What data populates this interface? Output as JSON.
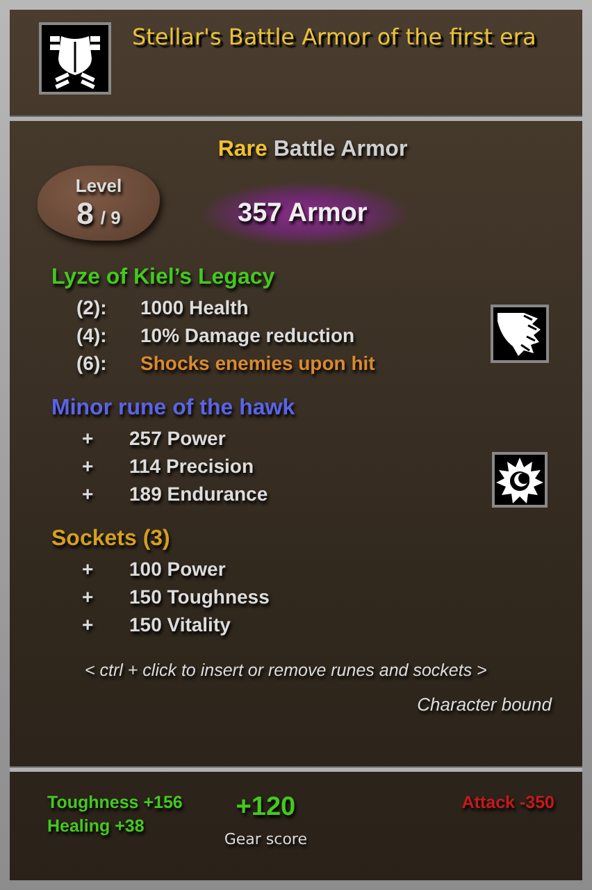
{
  "item": {
    "title": "Stellar's Battle Armor of the first era",
    "rarity": "Rare",
    "type": "Battle Armor",
    "level_label": "Level",
    "level": "8",
    "level_max": "/ 9",
    "armor": "357 Armor"
  },
  "set_bonus": {
    "title": "Lyze of Kiel’s Legacy",
    "bonuses": [
      {
        "count": "(2):",
        "text": "1000 Health",
        "highlighted": false
      },
      {
        "count": "(4):",
        "text": "10% Damage reduction",
        "highlighted": false
      },
      {
        "count": "(6):",
        "text": "Shocks enemies upon hit",
        "highlighted": true
      }
    ]
  },
  "rune": {
    "title": "Minor rune of the hawk",
    "stats": [
      {
        "sign": "+",
        "text": "257 Power"
      },
      {
        "sign": "+",
        "text": "114 Precision"
      },
      {
        "sign": "+",
        "text": "189 Endurance"
      }
    ]
  },
  "sockets": {
    "title": "Sockets (3)",
    "stats": [
      {
        "sign": "+",
        "text": "100 Power"
      },
      {
        "sign": "+",
        "text": "150 Toughness"
      },
      {
        "sign": "+",
        "text": "150 Vitality"
      }
    ]
  },
  "hint": "< ctrl + click to insert or remove runes and sockets >",
  "binding": "Character bound",
  "comparison": {
    "gains": [
      "Toughness +156",
      "Healing +38"
    ],
    "score": "+120",
    "score_label": "Gear score",
    "losses": [
      "Attack -350"
    ]
  }
}
